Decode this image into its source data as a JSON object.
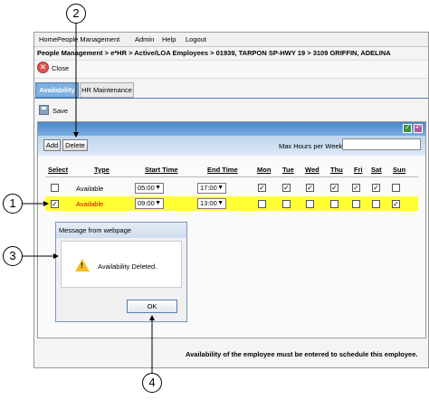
{
  "menu": {
    "items": [
      "Home",
      "People Management",
      "Admin",
      "Help",
      "Logout"
    ]
  },
  "breadcrumb": "People Management > e*HR > Active/LOA Employees > 01939, TARPON SP-HWY 19 > 3109 GRIFFIN, ADELINA",
  "toolbar": {
    "close_label": "Close",
    "save_label": "Save"
  },
  "tabs": [
    {
      "label": "Availability",
      "active": true
    },
    {
      "label": "HR Maintenance",
      "active": false
    }
  ],
  "grid": {
    "add_label": "Add",
    "delete_label": "Delete",
    "max_hours_label": "Max Hours per Week",
    "max_hours_value": "",
    "headers": {
      "select": "Select",
      "type": "Type",
      "start": "Start Time",
      "end": "End Time",
      "days": [
        "Mon",
        "Tue",
        "Wed",
        "Thu",
        "Fri",
        "Sat",
        "Sun"
      ]
    },
    "rows": [
      {
        "selected": false,
        "type": "Available",
        "start": "05:00",
        "end": "17:00",
        "days": [
          true,
          true,
          true,
          true,
          true,
          true,
          false
        ]
      },
      {
        "selected": true,
        "type": "Available",
        "start": "09:00",
        "end": "13:00",
        "days": [
          false,
          false,
          false,
          false,
          false,
          false,
          true
        ]
      }
    ]
  },
  "dialog": {
    "title": "Message from webpage",
    "message": "Availability Deleted.",
    "ok_label": "OK"
  },
  "footer_note": "Availability of the employee must be entered to schedule this employee.",
  "callouts": [
    "1",
    "2",
    "3",
    "4"
  ],
  "colors": {
    "accent": "#4a86c9",
    "highlight_row": "#ffff33",
    "available_text_selected": "#d80000",
    "warning": "#f0c020"
  }
}
